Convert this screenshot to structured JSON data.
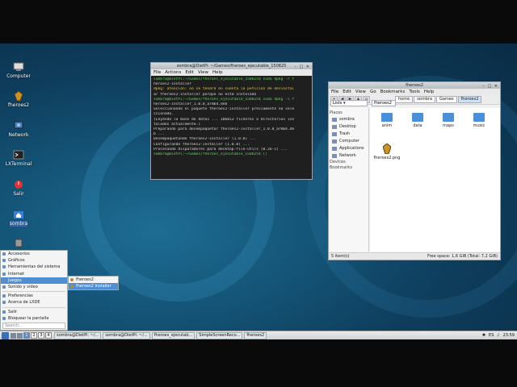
{
  "desktop": {
    "icons": [
      {
        "name": "computer",
        "label": "Computer"
      },
      {
        "name": "fheroes2",
        "label": "fheroes2"
      },
      {
        "name": "network",
        "label": "Network"
      },
      {
        "name": "terminal",
        "label": "LXTerminal"
      },
      {
        "name": "logout",
        "label": "Salir"
      },
      {
        "name": "home",
        "label": "sombra"
      },
      {
        "name": "trash",
        "label": ""
      }
    ]
  },
  "terminal": {
    "title": "sombra@DietPi: ~/Games/fheroes_ejecutable_150825",
    "menu": [
      "File",
      "Actions",
      "Edit",
      "View",
      "Help"
    ],
    "lines": [
      {
        "c": "g",
        "t": "sombra@DietPi:~/Games/fheroes_ejecutable_150825$ sudo dpkg -r f"
      },
      {
        "c": "",
        "t": "heroes2-installer"
      },
      {
        "c": "y",
        "t": "dpkg: atención: no se tendrá en cuenta la petición de desinstal"
      },
      {
        "c": "",
        "t": "ar fheroes2-installer porque no está instalado"
      },
      {
        "c": "g",
        "t": "sombra@DietPi:~/Games/fheroes_ejecutable_150825$ sudo dpkg -i f"
      },
      {
        "c": "",
        "t": "heroes2-installer_1.0.8_arm64.deb"
      },
      {
        "c": "",
        "t": "Seleccionando el paquete fheroes2-installer previamente no sele"
      },
      {
        "c": "",
        "t": "ccionado."
      },
      {
        "c": "",
        "t": "(Leyendo la base de datos ... 186813 ficheros o directorios ins"
      },
      {
        "c": "",
        "t": "talados actualmente.)"
      },
      {
        "c": "",
        "t": "Preparando para desempaquetar fheroes2-installer_1.0.8_arm64.de"
      },
      {
        "c": "",
        "t": "b ..."
      },
      {
        "c": "",
        "t": "Desempaquetando fheroes2-installer (1.0.8) ..."
      },
      {
        "c": "",
        "t": "Configurando fheroes2-installer (1.0.8) ..."
      },
      {
        "c": "",
        "t": "Procesando disparadores para desktop-file-utils (0.26-1) ..."
      },
      {
        "c": "g",
        "t": "sombra@DietPi:~/Games/fheroes_ejecutable_150825$ []"
      }
    ]
  },
  "filemanager": {
    "title": "fheroes2",
    "menu": [
      "File",
      "Edit",
      "View",
      "Go",
      "Bookmarks",
      "Tools",
      "Help"
    ],
    "breadcrumbs": [
      "home",
      "sombra",
      "Games",
      "fheroes2"
    ],
    "view_mode": "Lists",
    "path": "fheroes2",
    "sidebar": {
      "places_header": "Places",
      "places": [
        "sombra",
        "Desktop",
        "Trash",
        "Computer",
        "Applications",
        "Network"
      ],
      "devices_header": "Devices",
      "bookmarks_header": "Bookmarks"
    },
    "items": [
      "anim",
      "data",
      "maps",
      "music",
      "fheroes2.png"
    ],
    "status_left": "5 item(s)",
    "status_right": "Free space: 1,6 GiB (Total: 7,2 GiB)"
  },
  "startmenu": {
    "items": [
      "Accesorios",
      "Gráficos",
      "Herramientas del sistema",
      "Internet",
      "Juegos",
      "Sonido y vídeo"
    ],
    "items2": [
      "Preferencias",
      "Acerca de LXDE"
    ],
    "items3": [
      "Salir",
      "Bloquear la pantalla"
    ],
    "search_placeholder": "Search...",
    "submenu": [
      "fheroes2",
      "fheroes2 Installer"
    ]
  },
  "taskbar": {
    "workspaces": [
      "1",
      "2",
      "3",
      "4"
    ],
    "tasks": [
      "sombra@DietPi: ~/...",
      "sombra@DietPi: ~/...",
      "fheroes_ejecutab...",
      "SimpleScreenReco...",
      "fheroes2"
    ],
    "tray_kbd": "ES",
    "clock": "23:59"
  }
}
